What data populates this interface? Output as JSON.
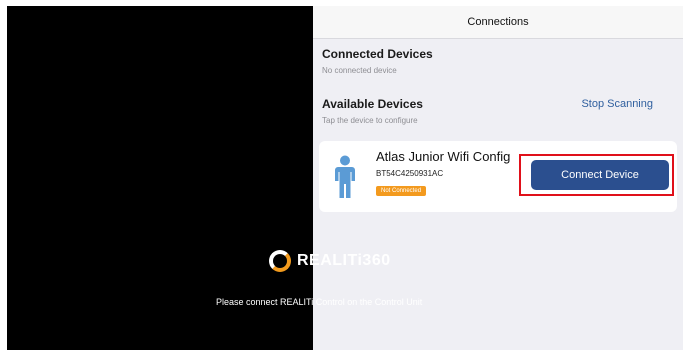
{
  "header": {
    "title": "Connections"
  },
  "connected": {
    "title": "Connected Devices",
    "subtitle": "No connected device"
  },
  "available": {
    "title": "Available Devices",
    "subtitle": "Tap the device to configure",
    "stop_scanning_label": "Stop Scanning"
  },
  "device": {
    "name": "Atlas Junior Wifi Config",
    "id": "BT54C4250931AC",
    "status": "Not Connected",
    "connect_label": "Connect Device"
  },
  "background": {
    "brand_name": "REALITi360",
    "prompt": "Please connect REALITi Control on the Control Unit"
  },
  "colors": {
    "accent": "#2b4f8f",
    "link": "#2f5f9e",
    "status_badge": "#f39a1e",
    "highlight": "#e0101a",
    "brand_orange": "#f29a1d"
  },
  "icons": {
    "device_icon": "person-icon",
    "brand_icon": "realiti-logo-icon"
  }
}
